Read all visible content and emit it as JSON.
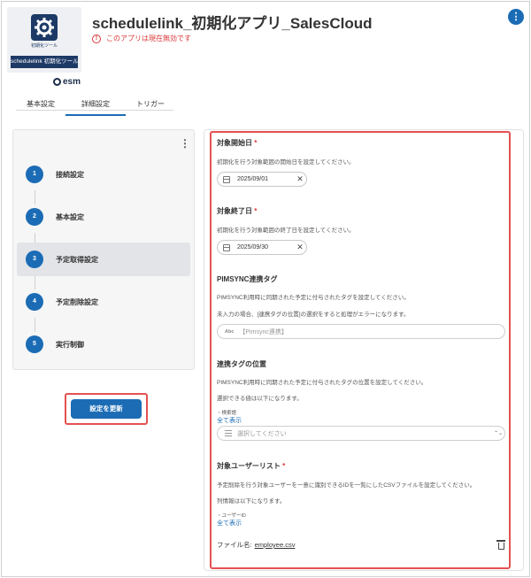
{
  "app": {
    "logo_text": "初期化ツール",
    "logo_banner": "schedulelink 初期化ツール",
    "brand": "esm",
    "title": "schedulelink_初期化アプリ_SalesCloud",
    "status": "このアプリは現在無効です"
  },
  "tabs": [
    {
      "label": "基本設定",
      "active": false
    },
    {
      "label": "詳細設定",
      "active": true
    },
    {
      "label": "トリガー",
      "active": false
    }
  ],
  "steps": [
    {
      "num": "1",
      "label": "接続設定",
      "active": false
    },
    {
      "num": "2",
      "label": "基本設定",
      "active": false
    },
    {
      "num": "3",
      "label": "予定取得設定",
      "active": true
    },
    {
      "num": "4",
      "label": "予定削除設定",
      "active": false
    },
    {
      "num": "5",
      "label": "実行制御",
      "active": false
    }
  ],
  "update_button": "設定を更新",
  "form": {
    "start_date": {
      "label": "対象開始日",
      "required": "*",
      "help": "初期化を行う対象範囲の開始日を設定してください。",
      "value": "2025/09/01"
    },
    "end_date": {
      "label": "対象終了日",
      "required": "*",
      "help": "初期化を行う対象範囲の終了日を設定してください。",
      "value": "2025/09/30"
    },
    "tag": {
      "label": "PIMSYNC連携タグ",
      "help1": "PIMSYNC利用時に同期された予定に付与されたタグを設定してください。",
      "help2": "未入力の場合、[連携タグの位置]の選択をすると処理がエラーになります。",
      "prefix": "Abc",
      "placeholder": "【Pimsync連携】"
    },
    "tag_position": {
      "label": "連携タグの位置",
      "help1": "PIMSYNC利用時に同期された予定に付与されたタグの位置を設定してください。",
      "help2": "選択できる値は以下になります。",
      "sublabel": "・検索語",
      "show_all": "全て表示",
      "placeholder": "選択してください"
    },
    "users": {
      "label": "対象ユーザーリスト",
      "required": "*",
      "help1": "予定削除を行う対象ユーザーを一意に識別できるIDを一覧にしたCSVファイルを設定してください。",
      "help2": "列情報は以下になります。",
      "sublabel": "・ユーザーID",
      "show_all": "全て表示",
      "file_label": "ファイル名:",
      "file_name": "employee.csv"
    }
  }
}
